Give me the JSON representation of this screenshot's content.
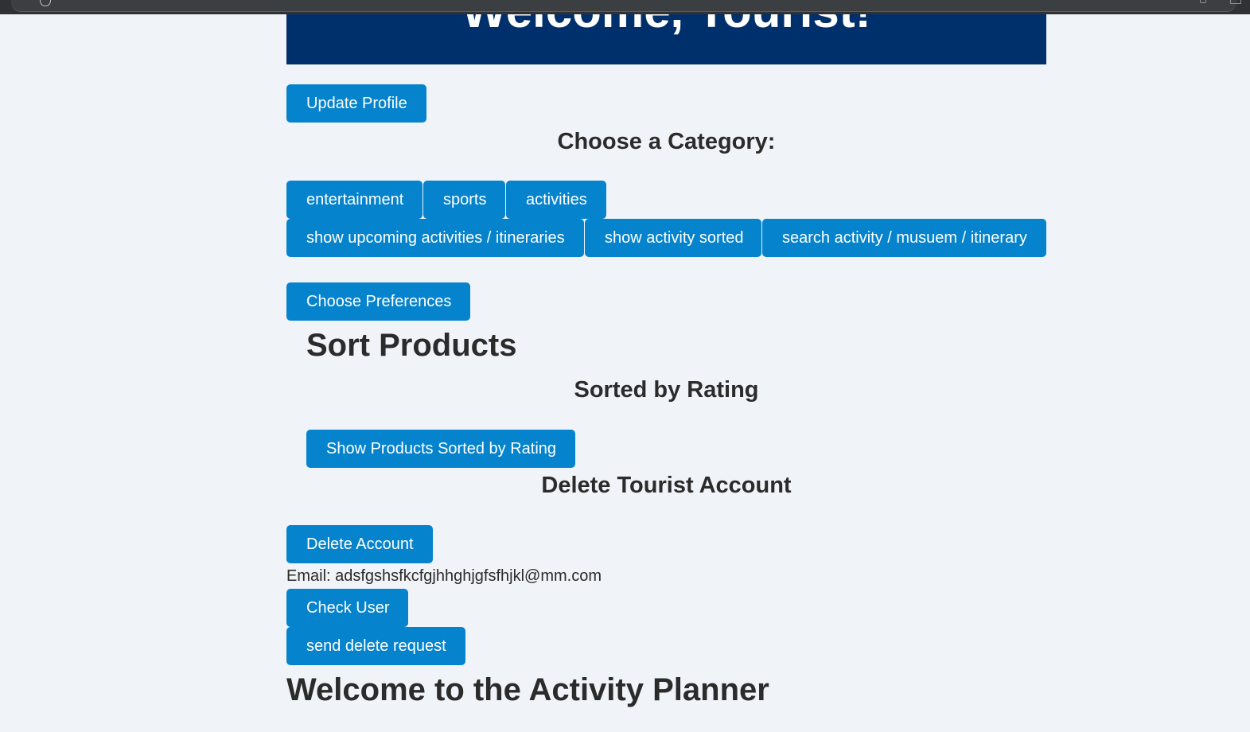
{
  "banner": {
    "title": "Welcome, Tourist!"
  },
  "profile": {
    "update_label": "Update Profile"
  },
  "category": {
    "heading": "Choose a Category:",
    "buttons": [
      "entertainment",
      "sports",
      "activities"
    ]
  },
  "actions": {
    "upcoming": "show upcoming activities / itineraries",
    "sorted": "show activity sorted",
    "search": "search activity / musuem / itinerary"
  },
  "preferences": {
    "button": "Choose Preferences"
  },
  "sort_products": {
    "heading": "Sort Products",
    "subheading": "Sorted by Rating",
    "button": "Show Products Sorted by Rating"
  },
  "delete_account": {
    "heading": "Delete Tourist Account",
    "button": "Delete Account",
    "email_label": "Email: adsfgshsfkcfgjhhghjgfsfhjkl@mm.com",
    "check_button": "Check User",
    "send_button": "send delete request"
  },
  "planner": {
    "heading": "Welcome to the Activity Planner"
  },
  "colors": {
    "banner": "#00306b",
    "button": "#0583cc",
    "page_background": "#f0f3f7",
    "text": "#2b2b2b"
  }
}
